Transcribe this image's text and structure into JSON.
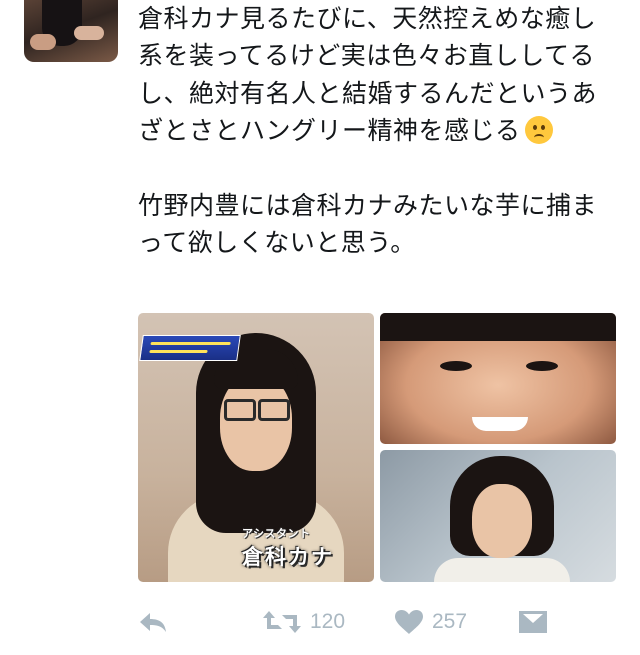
{
  "tweet": {
    "paragraph_1": "倉科カナ見るたびに、天然控えめな癒し系を装ってるけど実は色々お直ししてるし、絶対有名人と結婚するんだというあざとさとハングリー精神を感じる",
    "emoji_icon": "slightly-frowning-face-emoji",
    "paragraph_2": "竹野内豊には倉科カナみたいな芋に捕まって欲しくないと思う。"
  },
  "media": {
    "photo_1": {
      "caption_small": "アシスタント",
      "caption_name": "倉科カナ"
    }
  },
  "actions": {
    "reply_icon": "reply-icon",
    "retweet_icon": "retweet-icon",
    "retweet_count": "120",
    "like_icon": "heart-icon",
    "like_count": "257",
    "dm_icon": "envelope-icon"
  },
  "colors": {
    "text": "#14171a",
    "action_gray": "#aab8c2",
    "background": "#ffffff"
  }
}
